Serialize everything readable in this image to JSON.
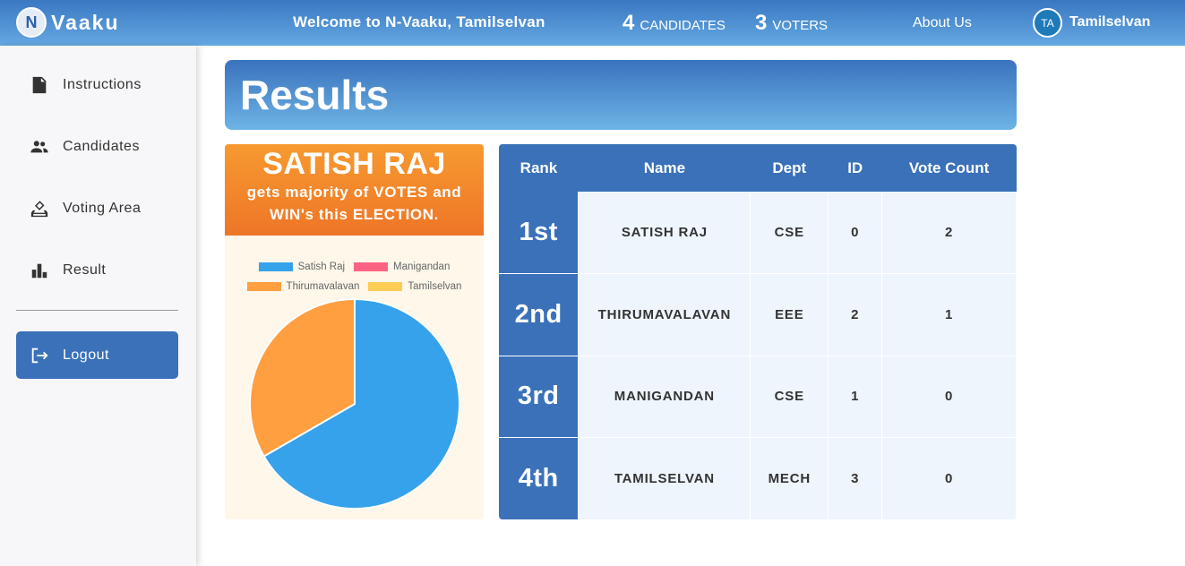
{
  "navbar": {
    "logo_letter": "N",
    "app_name": "Vaaku",
    "welcome": "Welcome to N-Vaaku, Tamilselvan",
    "candidates_count": "4",
    "candidates_label": "CANDIDATES",
    "voters_count": "3",
    "voters_label": "VOTERS",
    "about": "About Us",
    "avatar_initials": "TA",
    "username": "Tamilselvan"
  },
  "sidebar": {
    "items": [
      {
        "label": "Instructions",
        "icon": "document-icon"
      },
      {
        "label": "Candidates",
        "icon": "people-icon"
      },
      {
        "label": "Voting Area",
        "icon": "ballot-icon"
      },
      {
        "label": "Result",
        "icon": "bar-chart-icon"
      }
    ],
    "logout": "Logout"
  },
  "page": {
    "title": "Results"
  },
  "winner": {
    "name": "SATISH RAJ",
    "line1": "gets majority of VOTES and",
    "line2": "WIN's this ELECTION."
  },
  "colors": {
    "primary": "#3a71b9",
    "orange": "#f2852b"
  },
  "chart_data": {
    "type": "pie",
    "labels": [
      "Satish Raj",
      "Manigandan",
      "Thirumavalavan",
      "Tamilselvan"
    ],
    "values": [
      2,
      0,
      1,
      0
    ],
    "colors": [
      "#36a2eb",
      "#ff6384",
      "#ff9f40",
      "#ffcd56"
    ],
    "legend_position": "top"
  },
  "table": {
    "headers": [
      "Rank",
      "Name",
      "Dept",
      "ID",
      "Vote Count"
    ],
    "rows": [
      {
        "rank": "1st",
        "name": "SATISH RAJ",
        "dept": "CSE",
        "id": "0",
        "votes": "2"
      },
      {
        "rank": "2nd",
        "name": "THIRUMAVALAVAN",
        "dept": "EEE",
        "id": "2",
        "votes": "1"
      },
      {
        "rank": "3rd",
        "name": "MANIGANDAN",
        "dept": "CSE",
        "id": "1",
        "votes": "0"
      },
      {
        "rank": "4th",
        "name": "TAMILSELVAN",
        "dept": "MECH",
        "id": "3",
        "votes": "0"
      }
    ]
  }
}
